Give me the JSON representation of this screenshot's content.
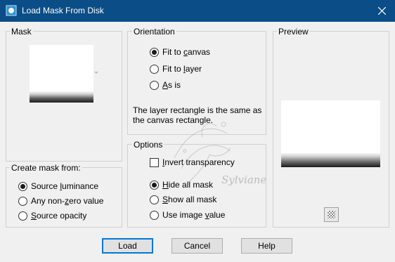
{
  "window": {
    "title": "Load Mask From Disk"
  },
  "mask_group": {
    "label": "Mask"
  },
  "create_mask": {
    "label": "Create mask from:",
    "options": [
      {
        "label": "Source luminance",
        "selected": true
      },
      {
        "label": "Any non-zero value",
        "selected": false
      },
      {
        "label": "Source opacity",
        "selected": false
      }
    ]
  },
  "orientation": {
    "label": "Orientation",
    "options": [
      {
        "label": "Fit to canvas",
        "selected": true
      },
      {
        "label": "Fit to layer",
        "selected": false
      },
      {
        "label": "As is",
        "selected": false
      }
    ],
    "info_line1": "The layer rectangle is the same as",
    "info_line2": "the canvas rectangle."
  },
  "options": {
    "label": "Options",
    "invert_label": "Invert transparency",
    "invert_checked": false,
    "visibility": [
      {
        "label": "Hide all mask",
        "selected": true
      },
      {
        "label": "Show all mask",
        "selected": false
      },
      {
        "label": "Use image value",
        "selected": false
      }
    ]
  },
  "preview": {
    "label": "Preview"
  },
  "buttons": {
    "load": "Load",
    "cancel": "Cancel",
    "help": "Help"
  },
  "watermark": {
    "text": "Sylviane"
  },
  "icons": {
    "app": "mask-app-icon",
    "close": "close-icon",
    "checker": "transparency-checker-icon"
  },
  "colors": {
    "titlebar": "#0b4d86",
    "focus": "#0078d7"
  }
}
